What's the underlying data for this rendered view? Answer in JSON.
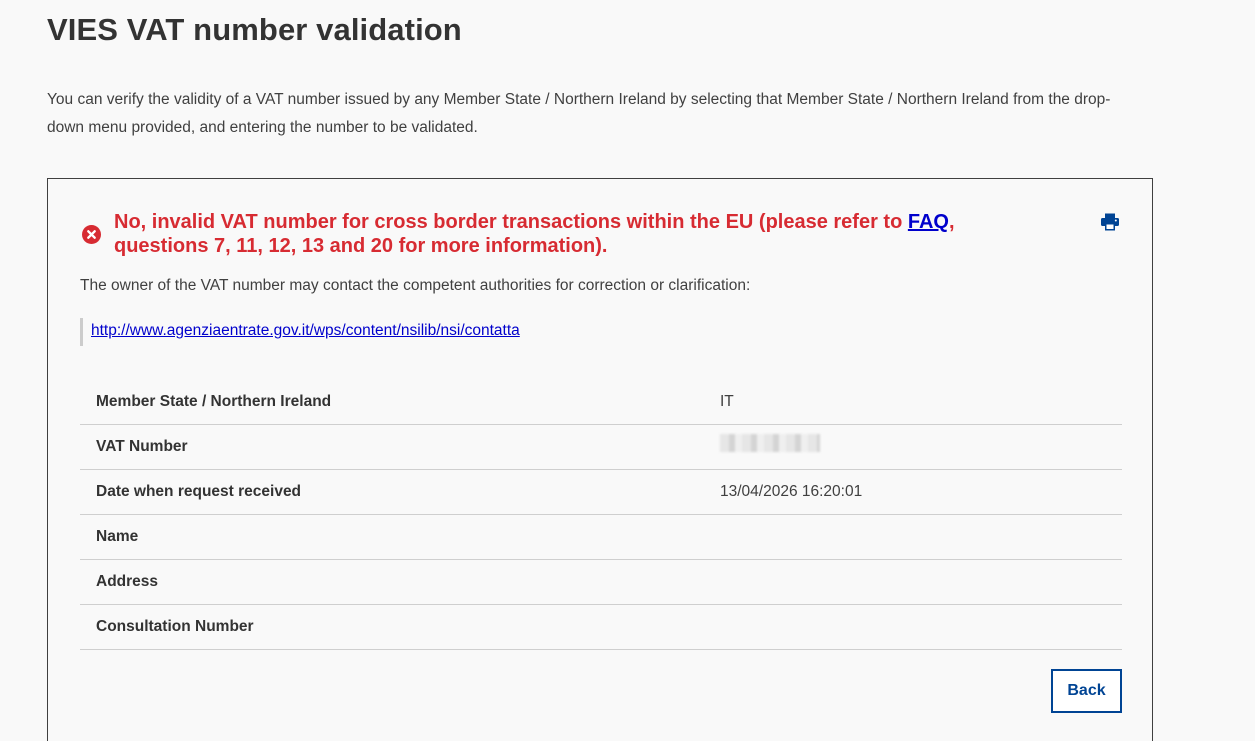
{
  "page": {
    "title": "VIES VAT number validation",
    "intro_line1": "You can verify the validity of a VAT number issued by any Member State / Northern Ireland by selecting that Member State / Northern Ireland from the drop-",
    "intro_line2": "down menu provided, and entering the number to be validated."
  },
  "result": {
    "status": "invalid",
    "heading_before_link": "No, invalid VAT number for cross border transactions within the EU (please refer to ",
    "faq_link_label": "FAQ",
    "heading_after_link": ",",
    "heading_line2": "questions 7, 11, 12, 13 and 20 for more information).",
    "owner_note": "The owner of the VAT number may contact the competent authorities for correction or clarification:",
    "authority_url_label": "http://www.agenziaentrate.gov.it/wps/content/nsilib/nsi/contatta",
    "error_icon": "error-circle-icon",
    "print_icon": "print-icon"
  },
  "details": [
    {
      "label": "Member State / Northern Ireland",
      "value": "IT"
    },
    {
      "label": "VAT Number",
      "value": ""
    },
    {
      "label": "Date when request received",
      "value": "13/04/2026 16:20:01"
    },
    {
      "label": "Name",
      "value": ""
    },
    {
      "label": "Address",
      "value": ""
    },
    {
      "label": "Consultation Number",
      "value": ""
    }
  ],
  "actions": {
    "back_label": "Back"
  },
  "colors": {
    "error": "#d72b32",
    "link": "#0000cc",
    "primary": "#004494",
    "text": "#333333"
  }
}
